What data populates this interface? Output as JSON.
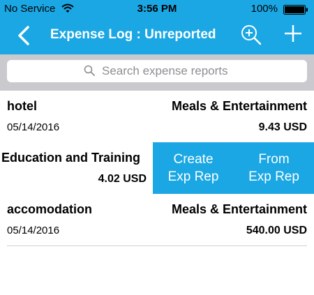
{
  "status_bar": {
    "carrier": "No Service",
    "time": "3:56 PM",
    "battery": "100%"
  },
  "nav": {
    "title": "Expense Log : Unreported"
  },
  "search": {
    "placeholder": "Search expense reports"
  },
  "rows": [
    {
      "name": "hotel",
      "category": "Meals & Entertainment",
      "date": "05/14/2016",
      "amount": "9.43 USD"
    },
    {
      "name": "Education and Training",
      "amount": "4.02 USD",
      "actions": [
        {
          "line1": "Create",
          "line2": "Exp Rep"
        },
        {
          "line1": "From",
          "line2": "Exp Rep"
        }
      ]
    },
    {
      "name": "accomodation",
      "category": "Meals & Entertainment",
      "date": "05/14/2016",
      "amount": "540.00 USD"
    }
  ],
  "colors": {
    "accent": "#1aa7e4",
    "search_bar_bg": "#c9c9ce",
    "placeholder": "#8e8e93"
  }
}
